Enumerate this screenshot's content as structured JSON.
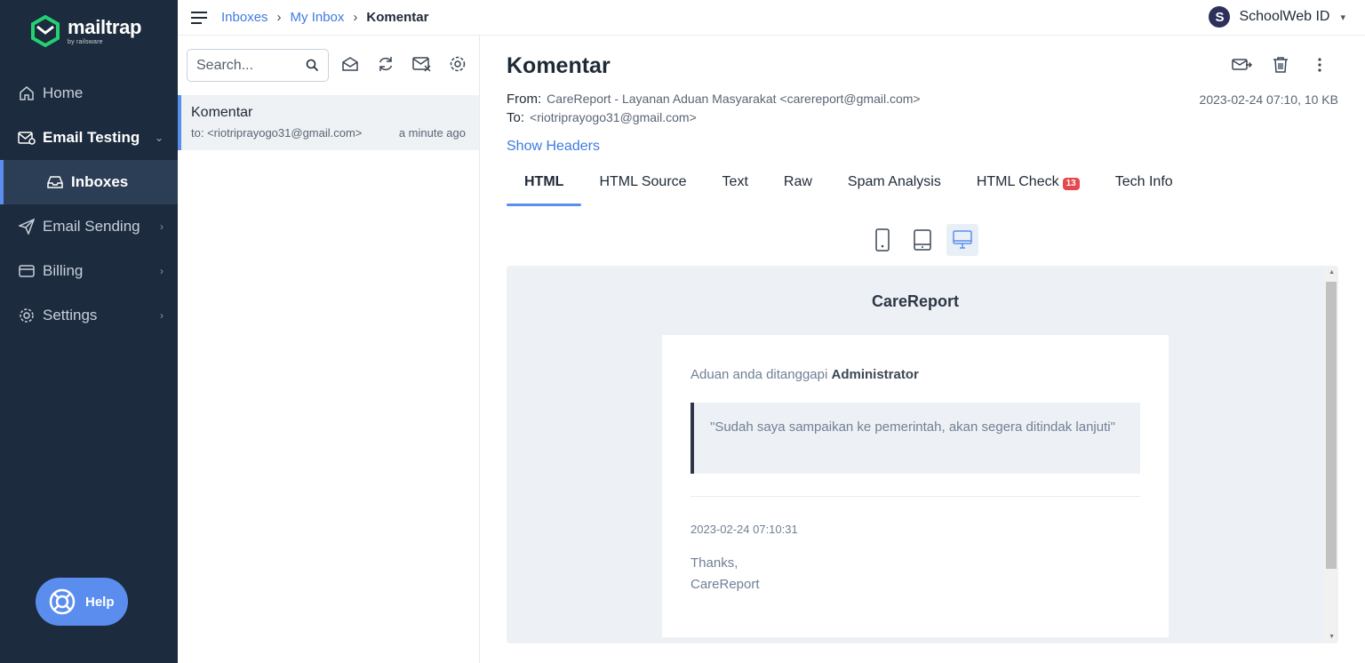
{
  "brand": {
    "name": "mailtrap",
    "sub": "by railsware"
  },
  "sidebar": {
    "items": [
      {
        "label": "Home",
        "icon": "home-icon"
      },
      {
        "label": "Email Testing",
        "icon": "email-testing-icon"
      },
      {
        "label": "Inboxes",
        "icon": "inbox-icon"
      },
      {
        "label": "Email Sending",
        "icon": "send-icon"
      },
      {
        "label": "Billing",
        "icon": "billing-icon"
      },
      {
        "label": "Settings",
        "icon": "settings-icon"
      }
    ],
    "help_label": "Help"
  },
  "breadcrumb": {
    "items": [
      "Inboxes",
      "My Inbox"
    ],
    "current": "Komentar"
  },
  "account": {
    "initial": "S",
    "name": "SchoolWeb ID"
  },
  "search": {
    "placeholder": "Search..."
  },
  "messages": [
    {
      "subject": "Komentar",
      "to": "to: <riotriprayogo31@gmail.com>",
      "time": "a minute ago"
    }
  ],
  "email": {
    "subject": "Komentar",
    "from_label": "From:",
    "from": "CareReport - Layanan Aduan Masyarakat <carereport@gmail.com>",
    "to_label": "To:",
    "to": "<riotriprayogo31@gmail.com>",
    "meta": "2023-02-24 07:10, 10 KB",
    "show_headers": "Show Headers"
  },
  "tabs": [
    {
      "label": "HTML",
      "active": true
    },
    {
      "label": "HTML Source"
    },
    {
      "label": "Text"
    },
    {
      "label": "Raw"
    },
    {
      "label": "Spam Analysis"
    },
    {
      "label": "HTML Check",
      "badge": "13"
    },
    {
      "label": "Tech Info"
    }
  ],
  "preview": {
    "brand": "CareReport",
    "intro": "Aduan anda ditanggapi",
    "responder": "Administrator",
    "quote": "\"Sudah saya sampaikan ke pemerintah, akan segera ditindak lanjuti\"",
    "date": "2023-02-24 07:10:31",
    "thanks": "Thanks,",
    "signature": "CareReport"
  },
  "colors": {
    "sidebar_bg": "#1c2b3d",
    "accent": "#5b8def",
    "link": "#3f7be0",
    "badge": "#e5484d"
  }
}
